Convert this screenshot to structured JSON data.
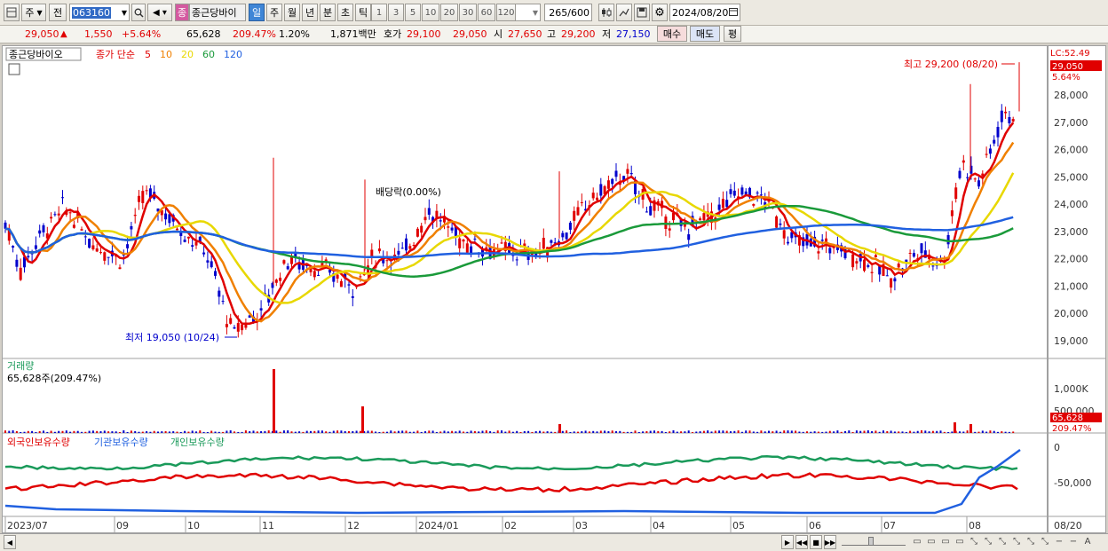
{
  "toolbar": {
    "market": "주",
    "prev": "전",
    "code": "063160",
    "name": "종근당바이",
    "name_badge": "종",
    "periods": [
      "일",
      "주",
      "월",
      "년",
      "분",
      "초",
      "틱"
    ],
    "active_period": "일",
    "intervals": [
      "1",
      "3",
      "5",
      "10",
      "20",
      "30",
      "60",
      "120"
    ],
    "count": "265",
    "count_total": "/600",
    "date": "2024/08/20"
  },
  "info": {
    "price": "29,050",
    "arrow": "▲",
    "change": "1,550",
    "change_pct": "+5.64%",
    "volume": "65,628",
    "vol_ratio": "209.47%",
    "turnover": "1.20%",
    "amount": "1,871백만",
    "bid_label": "호가",
    "ask": "29,100",
    "bid": "29,050",
    "open_label": "시",
    "open": "27,650",
    "high_label": "고",
    "high": "29,200",
    "low_label": "저",
    "low": "27,150",
    "buy_btn": "매수",
    "sell_btn": "매도",
    "avg_btn": "평"
  },
  "price_panel": {
    "legend_name": "종근당바이오",
    "legend_type": "종가 단순",
    "ma_labels": [
      {
        "label": "5",
        "color": "#e00000"
      },
      {
        "label": "10",
        "color": "#f08000"
      },
      {
        "label": "20",
        "color": "#e8d800"
      },
      {
        "label": "60",
        "color": "#1a9a3a"
      },
      {
        "label": "120",
        "color": "#2060e0"
      }
    ],
    "dividend_note": "배당락(0.00%)",
    "high_note": "최고 29,200 (08/20)",
    "low_note": "최저 19,050 (10/24)",
    "lc": "LC:52.49",
    "last_price": "29,050",
    "last_pct": "5.64%",
    "y_ticks": [
      "28,000",
      "27,000",
      "26,000",
      "25,000",
      "24,000",
      "23,000",
      "22,000",
      "21,000",
      "20,000",
      "19,000"
    ]
  },
  "volume_panel": {
    "title": "거래량",
    "summary": "65,628주(209.47%)",
    "y_ticks": [
      "1,000K",
      "500,000"
    ],
    "last_volume": "65,628",
    "last_pct": "209.47%"
  },
  "holdings_panel": {
    "series": [
      {
        "name": "외국인보유수량",
        "color": "#e00000"
      },
      {
        "name": "기관보유수량",
        "color": "#2060e0"
      },
      {
        "name": "개인보유수량",
        "color": "#1a9a5a"
      }
    ],
    "y_ticks": [
      "0",
      "-50,000"
    ]
  },
  "x_axis": {
    "labels": [
      "2023/07",
      "09",
      "10",
      "11",
      "12",
      "2024/01",
      "02",
      "03",
      "04",
      "05",
      "06",
      "07",
      "08"
    ],
    "last_label": "08/20"
  },
  "colors": {
    "up": "#e00000",
    "down": "#0000cc",
    "accent": "#3f86d6"
  }
}
